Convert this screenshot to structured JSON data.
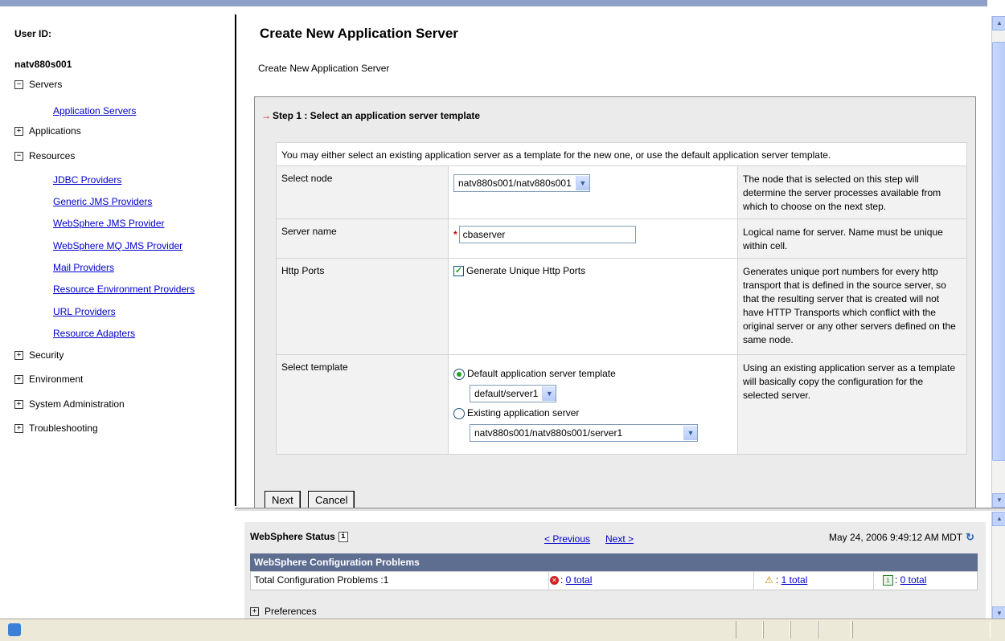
{
  "nav": {
    "user_label": "User ID:",
    "node": "natv880s001",
    "servers": {
      "toggle": "−",
      "label": "Servers",
      "items": [
        "Application Servers"
      ]
    },
    "applications": {
      "toggle": "+",
      "label": "Applications"
    },
    "resources": {
      "toggle": "−",
      "label": "Resources",
      "items": [
        "JDBC Providers",
        "Generic JMS Providers",
        "WebSphere JMS Provider",
        "WebSphere MQ JMS Provider",
        "Mail Providers",
        "Resource Environment Providers",
        "URL Providers",
        "Resource Adapters"
      ]
    },
    "security": {
      "toggle": "+",
      "label": "Security"
    },
    "environment": {
      "toggle": "+",
      "label": "Environment"
    },
    "system_admin": {
      "toggle": "+",
      "label": "System Administration"
    },
    "troubleshooting": {
      "toggle": "+",
      "label": "Troubleshooting"
    }
  },
  "main": {
    "title": "Create New Application Server",
    "subtitle": "Create New Application Server",
    "step": {
      "arrow": "→",
      "label": "Step 1 :  Select an application server template"
    },
    "intro": "You may either select an existing application server as a template for the new one, or use the default application server template.",
    "rows": {
      "node": {
        "label": "Select node",
        "value": "natv880s001/natv880s001",
        "desc": "The node that is selected on this step will determine the server processes available from which to choose on the next step."
      },
      "server_name": {
        "label": "Server name",
        "value": "cbaserver",
        "desc": "Logical name for server. Name must be unique within cell."
      },
      "http_ports": {
        "label": "Http Ports",
        "checkbox_label": "Generate Unique Http Ports",
        "checked": true,
        "desc": "Generates unique port numbers for every http transport that is defined in the source server, so that the resulting server that is created will not have HTTP Transports which conflict with the original server or any other servers defined on the same node."
      },
      "template": {
        "label": "Select template",
        "default_radio": "Default application server template",
        "default_value": "default/server1",
        "existing_radio": "Existing application server",
        "existing_value": "natv880s001/natv880s001/server1",
        "desc": "Using an existing application server as a template will basically copy the configuration for the selected server."
      }
    },
    "buttons": {
      "next": "Next",
      "cancel": "Cancel"
    }
  },
  "status": {
    "title": "WebSphere Status",
    "prev": "< Previous",
    "next": "Next >",
    "timestamp": "May 24, 2006 9:49:12 AM MDT",
    "config_header": "WebSphere Configuration Problems",
    "total_label": "Total Configuration Problems :1",
    "errors": "0 total",
    "warnings": "1 total",
    "infos": "0 total",
    "preferences": "Preferences"
  }
}
